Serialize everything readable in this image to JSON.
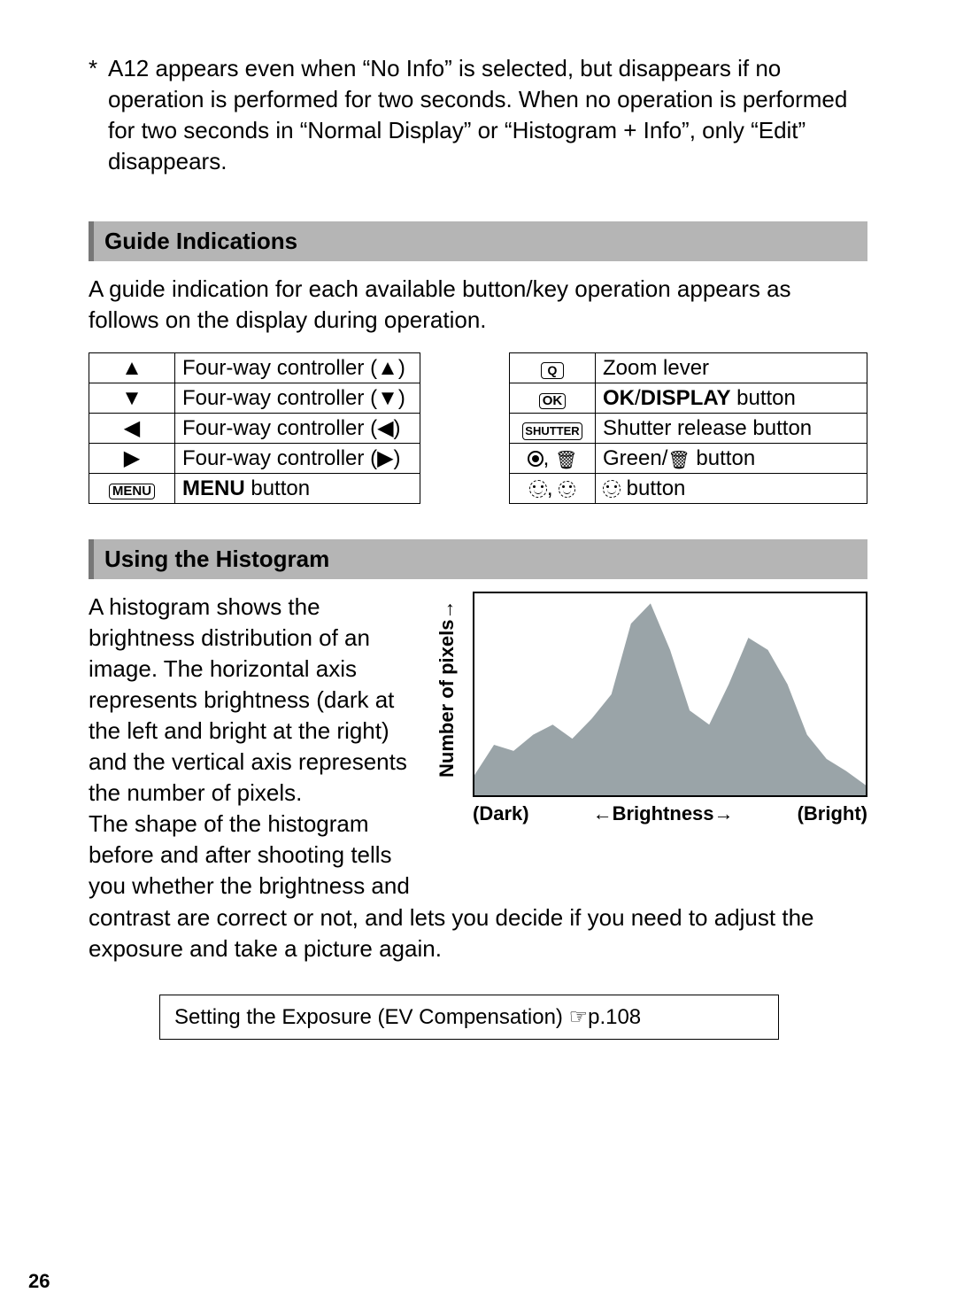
{
  "top_note_ast": "*",
  "top_note": "A12 appears even when “No Info” is selected, but disappears if no operation is performed for two seconds. When no operation is performed for two seconds in “Normal Display” or “Histogram + Info”, only “Edit” disappears.",
  "section_guide": "Guide Indications",
  "guide_intro": "A guide indication for each available button/key operation appears as follows on the display during operation.",
  "table_left": [
    {
      "sym_type": "glyph",
      "sym": "▲",
      "desc_plain": "Four-way controller (",
      "desc_suffix_glyph": "▲",
      "desc_close": ")"
    },
    {
      "sym_type": "glyph",
      "sym": "▼",
      "desc_plain": "Four-way controller (",
      "desc_suffix_glyph": "▼",
      "desc_close": ")"
    },
    {
      "sym_type": "glyph",
      "sym": "◀",
      "desc_plain": "Four-way controller (",
      "desc_suffix_glyph": "◀",
      "desc_close": ")"
    },
    {
      "sym_type": "glyph",
      "sym": "▶",
      "desc_plain": "Four-way controller (",
      "desc_suffix_glyph": "▶",
      "desc_close": ")"
    },
    {
      "sym_type": "kbd",
      "sym": "MENU",
      "desc_bold": "MENU",
      "desc_rest": " button"
    }
  ],
  "table_right": [
    {
      "sym_type": "zoom",
      "sym": "Q",
      "desc": "Zoom lever"
    },
    {
      "sym_type": "kbd",
      "sym": "OK",
      "desc_bold": "OK",
      "desc_mid": "/",
      "desc_bold2": "DISPLAY",
      "desc_rest": " button"
    },
    {
      "sym_type": "kbd",
      "sym": "SHUTTER",
      "desc": "Shutter release button"
    },
    {
      "sym_type": "green_trash",
      "desc_pre": "Green/",
      "desc_post": " button"
    },
    {
      "sym_type": "faces",
      "desc_post": " button"
    }
  ],
  "section_hist": "Using the Histogram",
  "hist_para_left": "A histogram shows the brightness distribution of an image. The horizontal axis represents brightness (dark at the left and bright at the right) and the vertical axis represents the number of pixels.\nThe shape of the histogram before and after shooting tells you whether the brightness and",
  "hist_para_cont": "contrast are correct or not, and lets you decide if you need to adjust the exposure and take a picture again.",
  "hist_ylabel": "Number of pixels",
  "hist_xlabel_dark": "(Dark)",
  "hist_xlabel_mid": "Brightness",
  "hist_xlabel_bright": "(Bright)",
  "ref_box_text": "Setting the Exposure (EV Compensation) ",
  "ref_box_page": "p.108",
  "page_number": "26",
  "chart_data": {
    "type": "area",
    "title": "Histogram (brightness distribution)",
    "xlabel": "Brightness (Dark → Bright)",
    "ylabel": "Number of pixels",
    "x": [
      0,
      5,
      10,
      15,
      20,
      25,
      30,
      35,
      40,
      45,
      50,
      55,
      60,
      65,
      70,
      75,
      80,
      85,
      90,
      95,
      100
    ],
    "values": [
      10,
      25,
      22,
      30,
      35,
      28,
      38,
      50,
      85,
      95,
      72,
      42,
      35,
      55,
      78,
      72,
      55,
      30,
      18,
      12,
      5
    ],
    "xlim": [
      0,
      100
    ],
    "ylim": [
      0,
      100
    ]
  }
}
